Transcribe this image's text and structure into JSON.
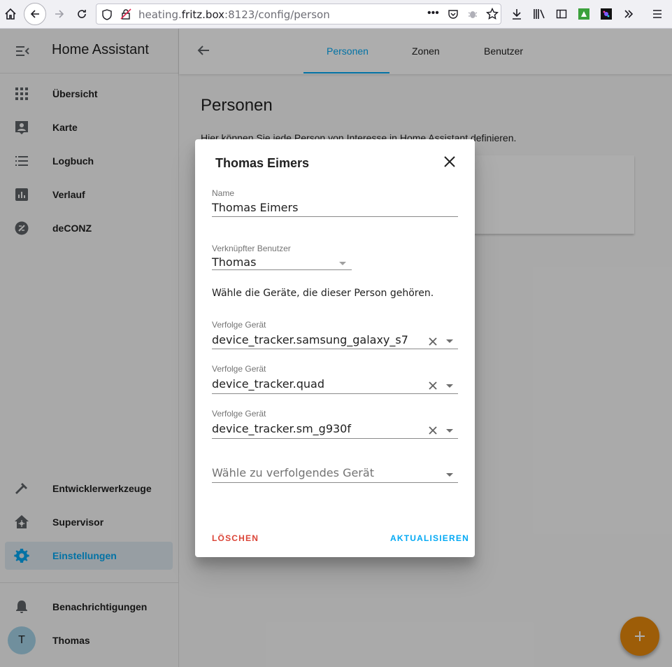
{
  "browser": {
    "url_host": "heating.",
    "url_domain": "fritz.box",
    "url_path": ":8123/config/person"
  },
  "sidebar": {
    "title": "Home Assistant",
    "items": [
      {
        "label": "Übersicht",
        "icon": "grid-icon"
      },
      {
        "label": "Karte",
        "icon": "map-account-icon"
      },
      {
        "label": "Logbuch",
        "icon": "list-icon"
      },
      {
        "label": "Verlauf",
        "icon": "chart-icon"
      },
      {
        "label": "deCONZ",
        "icon": "deconz-icon"
      }
    ],
    "bottom_items": [
      {
        "label": "Entwicklerwerkzeuge",
        "icon": "hammer-icon"
      },
      {
        "label": "Supervisor",
        "icon": "supervisor-icon"
      },
      {
        "label": "Einstellungen",
        "icon": "gear-icon",
        "active": true
      }
    ],
    "notifications_label": "Benachrichtigungen",
    "user_initial": "T",
    "user_label": "Thomas"
  },
  "tabs": [
    {
      "label": "Personen",
      "active": true
    },
    {
      "label": "Zonen"
    },
    {
      "label": "Benutzer"
    }
  ],
  "page": {
    "title": "Personen",
    "description": "Hier können Sie jede Person von Interesse in Home Assistant definieren."
  },
  "dialog": {
    "title": "Thomas Eimers",
    "name_label": "Name",
    "name_value": "Thomas Eimers",
    "user_label": "Verknüpfter Benutzer",
    "user_value": "Thomas",
    "help": "Wähle die Geräte, die dieser Person gehören.",
    "trackers": [
      {
        "label": "Verfolge Gerät",
        "value": "device_tracker.samsung_galaxy_s7"
      },
      {
        "label": "Verfolge Gerät",
        "value": "device_tracker.quad"
      },
      {
        "label": "Verfolge Gerät",
        "value": "device_tracker.sm_g930f"
      }
    ],
    "new_tracker_placeholder": "Wähle zu verfolgendes Gerät",
    "delete_label": "LÖSCHEN",
    "update_label": "AKTUALISIEREN"
  },
  "colors": {
    "primary": "#03a9f4",
    "accent": "#e8890c",
    "danger": "#db4437"
  }
}
